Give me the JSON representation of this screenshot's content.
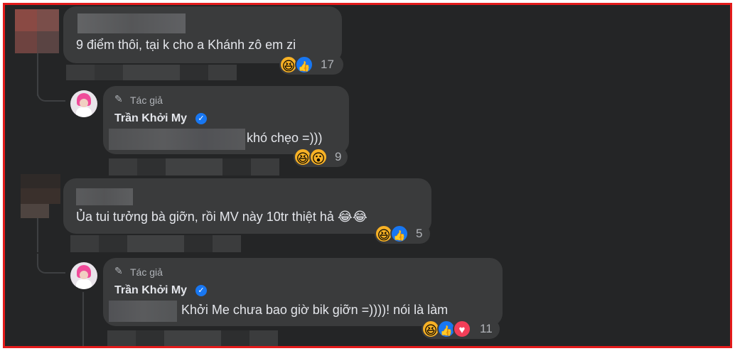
{
  "comments": [
    {
      "text": "9 điểm thôi, tại k cho a Khánh zô em zi",
      "reaction_count": "17",
      "reactions": [
        "haha",
        "like"
      ]
    },
    {
      "author_tag": "Tác giả",
      "author_name": "Trần Khởi My",
      "text": "khó chẹo =)))",
      "reaction_count": "9",
      "reactions": [
        "haha",
        "wow"
      ]
    },
    {
      "text": "Ủa tui tưởng bà giỡn, rồi MV này 10tr thiệt hả 😂😂",
      "reaction_count": "5",
      "reactions": [
        "haha",
        "like"
      ]
    },
    {
      "author_tag": "Tác giả",
      "author_name": "Trần Khởi My",
      "text": "Khởi Me chưa bao giờ bik giỡn =))))! nói là làm",
      "reaction_count": "11",
      "reactions": [
        "haha",
        "like",
        "love"
      ]
    }
  ],
  "colors": {
    "background": "#242526",
    "bubble": "#3a3b3c",
    "frame_border": "#e41b1b",
    "verified": "#1877f2"
  }
}
